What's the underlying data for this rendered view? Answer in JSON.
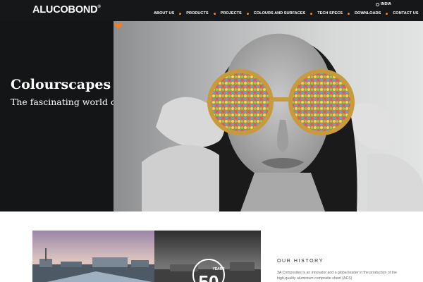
{
  "header": {
    "logo": "ALUCOBOND",
    "logo_mark": "®",
    "region": "INDIA",
    "nav": [
      "ABOUT US",
      "PRODUCTS",
      "PROJECTS",
      "COLOURS AND SURFACES",
      "TECH SPECS",
      "DOWNLOADS",
      "CONTACT US"
    ]
  },
  "hero": {
    "title": "Colourscapes",
    "subtitle": "The fascinating world of hues."
  },
  "history": {
    "heading": "OUR HISTORY",
    "body": "3A Composites is an innovator and a global leader in the production of the high-quality aluminium composite sheet (ACS)",
    "badge_text": "YEARS",
    "badge_number": "50"
  },
  "colors": {
    "header_bg": "#161718",
    "accent": "#e8812f",
    "hero_panel": "#131516"
  }
}
